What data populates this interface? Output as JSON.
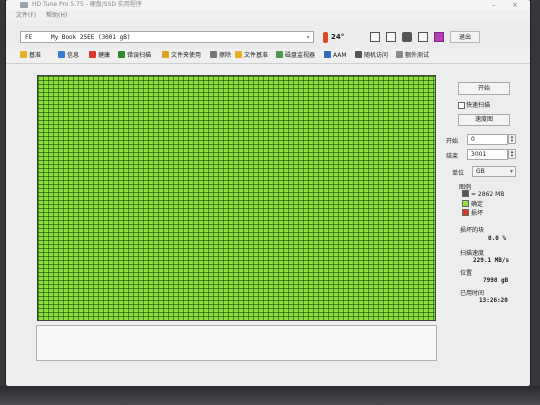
{
  "window": {
    "title": "HD Tune Pro 5.75 - 硬盘/SSD 实用程序",
    "minimize": "–",
    "close": "×"
  },
  "menu": [
    "文件(F)",
    "帮助(H)"
  ],
  "drive": {
    "letter": "FE",
    "name": "My Book 25EE (3001 gB)",
    "temperature": "24°"
  },
  "toolbar": {
    "exit_label": "退出"
  },
  "tabs": [
    {
      "label": "基准",
      "icon": "benchmark-icon",
      "color": "#e8b020"
    },
    {
      "label": "信息",
      "icon": "info-icon",
      "color": "#3a7bd5"
    },
    {
      "label": "健康",
      "icon": "health-icon",
      "color": "#d83a2a"
    },
    {
      "label": "错误扫描",
      "icon": "error-scan-icon",
      "color": "#2c8a2c"
    },
    {
      "label": "文件夹使用",
      "icon": "folder-usage-icon",
      "color": "#e0a020"
    },
    {
      "label": "擦除",
      "icon": "erase-icon",
      "color": "#777777"
    },
    {
      "label": "文件基准",
      "icon": "file-benchmark-icon",
      "color": "#e8b020"
    },
    {
      "label": "磁盘监视器",
      "icon": "disk-monitor-icon",
      "color": "#4a9a4a"
    },
    {
      "label": "AAM",
      "icon": "aam-icon",
      "color": "#2e6fb8"
    },
    {
      "label": "随机访问",
      "icon": "random-access-icon",
      "color": "#555555"
    },
    {
      "label": "额外测试",
      "icon": "extra-tests-icon",
      "color": "#8a8a8a"
    }
  ],
  "scan": {
    "start_button": "开始",
    "quick_scan_label": "快速扫描",
    "quick_scan_checked": false,
    "speed_map_button": "速度图",
    "start_label": "开始",
    "start_value": "0",
    "end_label": "结束",
    "end_value": "3001",
    "unit_label": "单位",
    "unit_value": "GB",
    "legend_title": "图例",
    "legend_block_size": "= 2862 MB",
    "legend_ok": "确定",
    "legend_damaged": "损坏",
    "ok_color": "#8ce03c",
    "damaged_color": "#d83a2a",
    "damaged_blocks_label": "损坏的块",
    "damaged_blocks_value": "0.0 %",
    "scan_speed_label": "扫描速度",
    "scan_speed_value": "229.1 MB/s",
    "position_label": "位置",
    "position_value": "7998 gB",
    "elapsed_label": "已用时间",
    "elapsed_value": "13:26:20"
  }
}
